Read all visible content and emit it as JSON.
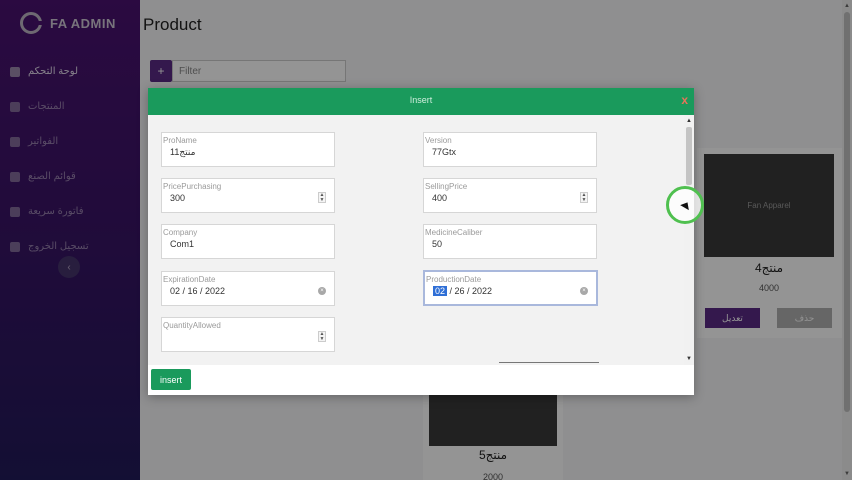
{
  "brand": {
    "title": "FA ADMIN"
  },
  "sidebar": {
    "items": [
      {
        "label": "لوحة التحكم"
      },
      {
        "label": "المنتجات"
      },
      {
        "label": "الفواتير"
      },
      {
        "label": "قوائم الصنع"
      },
      {
        "label": "فاتورة سريعة"
      },
      {
        "label": "تسجيل الخروج"
      }
    ],
    "collapse_icon": "chevron-left-icon"
  },
  "page": {
    "title": "Product",
    "filter_placeholder": "Filter",
    "add_button": "+"
  },
  "cards": [
    {
      "image_label": "Fan Apparel",
      "name": "منتج4",
      "price": "4000",
      "edit_label": "تعديل",
      "delete_label": "حذف"
    },
    {
      "image_label": "",
      "name": "منتج5",
      "price": "2000"
    }
  ],
  "modal": {
    "title": "Insert",
    "close": "x",
    "fields": {
      "proname": {
        "label": "ProName",
        "value": "منتج11"
      },
      "version": {
        "label": "Version",
        "value": "77Gtx"
      },
      "price_purchasing": {
        "label": "PricePurchasing",
        "value": "300"
      },
      "selling_price": {
        "label": "SellingPrice",
        "value": "400"
      },
      "company": {
        "label": "Company",
        "value": "Com1"
      },
      "medicine_caliber": {
        "label": "MedicineCaliber",
        "value": "50"
      },
      "expiration_date": {
        "label": "ExpirationDate",
        "value": "02 / 16 / 2022"
      },
      "production_date": {
        "label": "ProductionDate",
        "month": "02",
        "rest": " / 26 / 2022"
      },
      "quantity_allowed": {
        "label": "QuantityAllowed",
        "value": ""
      }
    },
    "insert_button": "insert"
  },
  "colors": {
    "sidebar": "#3a1466",
    "modal_header": "#1a9a5c",
    "accent": "#5b2a86",
    "close": "#e8745a"
  }
}
